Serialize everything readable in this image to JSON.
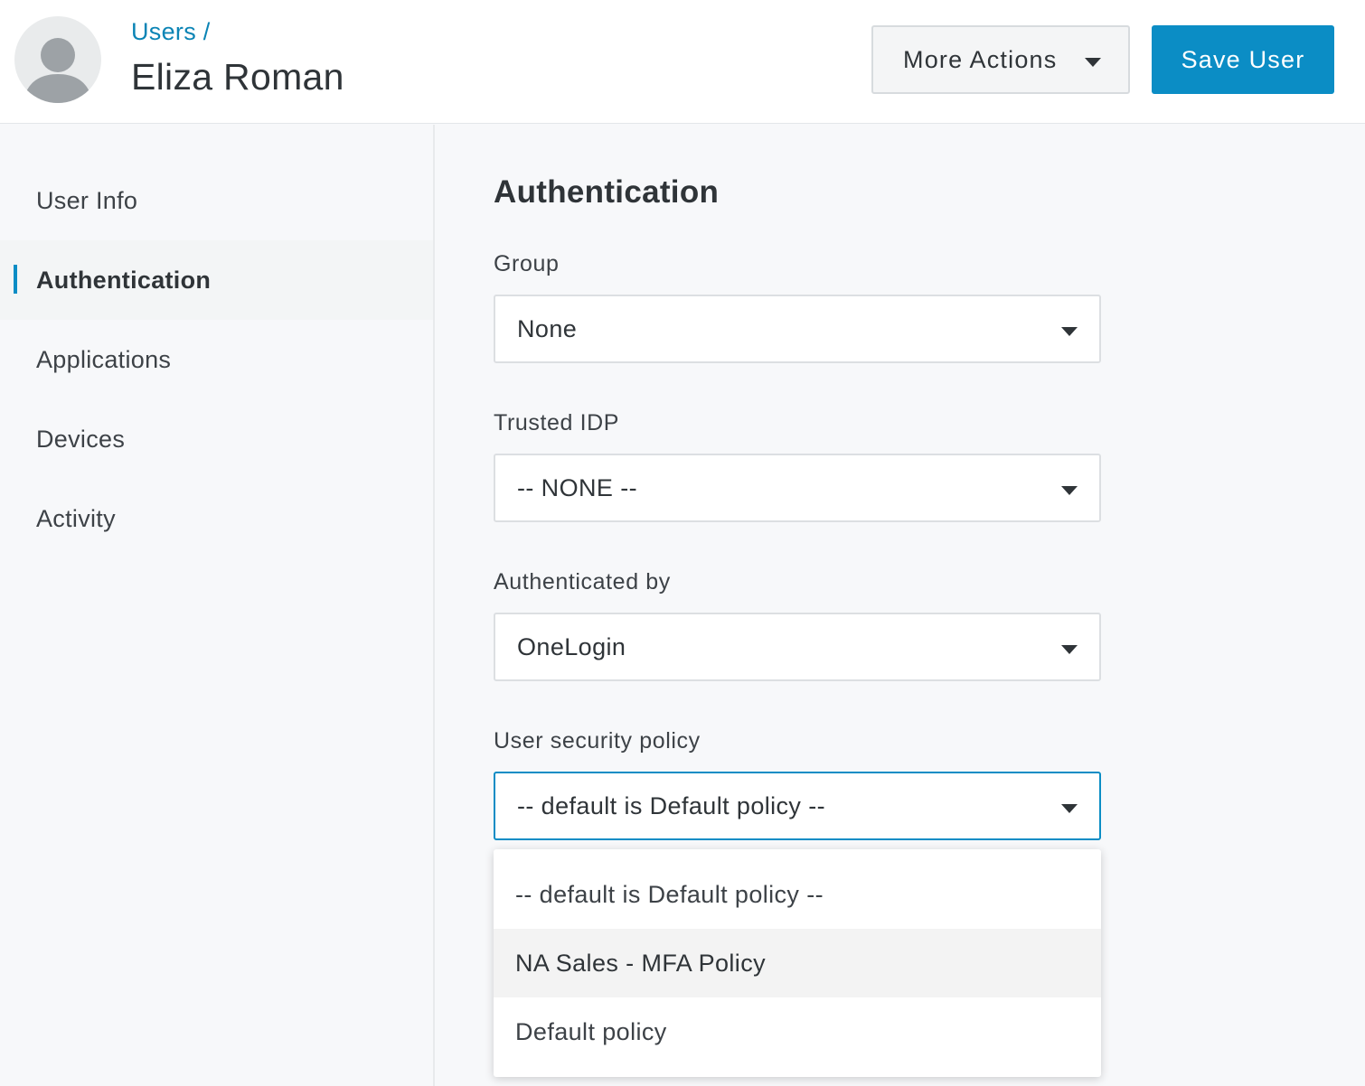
{
  "header": {
    "breadcrumb": "Users /",
    "title": "Eliza Roman",
    "more_actions_label": "More Actions",
    "save_label": "Save User"
  },
  "sidebar": {
    "items": [
      {
        "label": "User Info",
        "active": false
      },
      {
        "label": "Authentication",
        "active": true
      },
      {
        "label": "Applications",
        "active": false
      },
      {
        "label": "Devices",
        "active": false
      },
      {
        "label": "Activity",
        "active": false
      }
    ]
  },
  "main": {
    "section_title": "Authentication",
    "fields": [
      {
        "label": "Group",
        "value": "None"
      },
      {
        "label": "Trusted IDP",
        "value": "-- NONE --"
      },
      {
        "label": "Authenticated by",
        "value": "OneLogin"
      },
      {
        "label": "User security policy",
        "value": "-- default is Default policy --",
        "focused": true
      }
    ],
    "policy_options": [
      "-- default is Default policy --",
      "NA Sales - MFA Policy",
      "Default policy"
    ],
    "highlighted_option": "NA Sales - MFA Policy"
  },
  "colors": {
    "accent": "#0b8dc5",
    "link": "#0b84b5",
    "text": "#2f3438",
    "sidebar_bg": "#f7f8fa"
  },
  "icons": {
    "avatar": "user-silhouette-icon",
    "dropdown": "caret-down-icon"
  }
}
